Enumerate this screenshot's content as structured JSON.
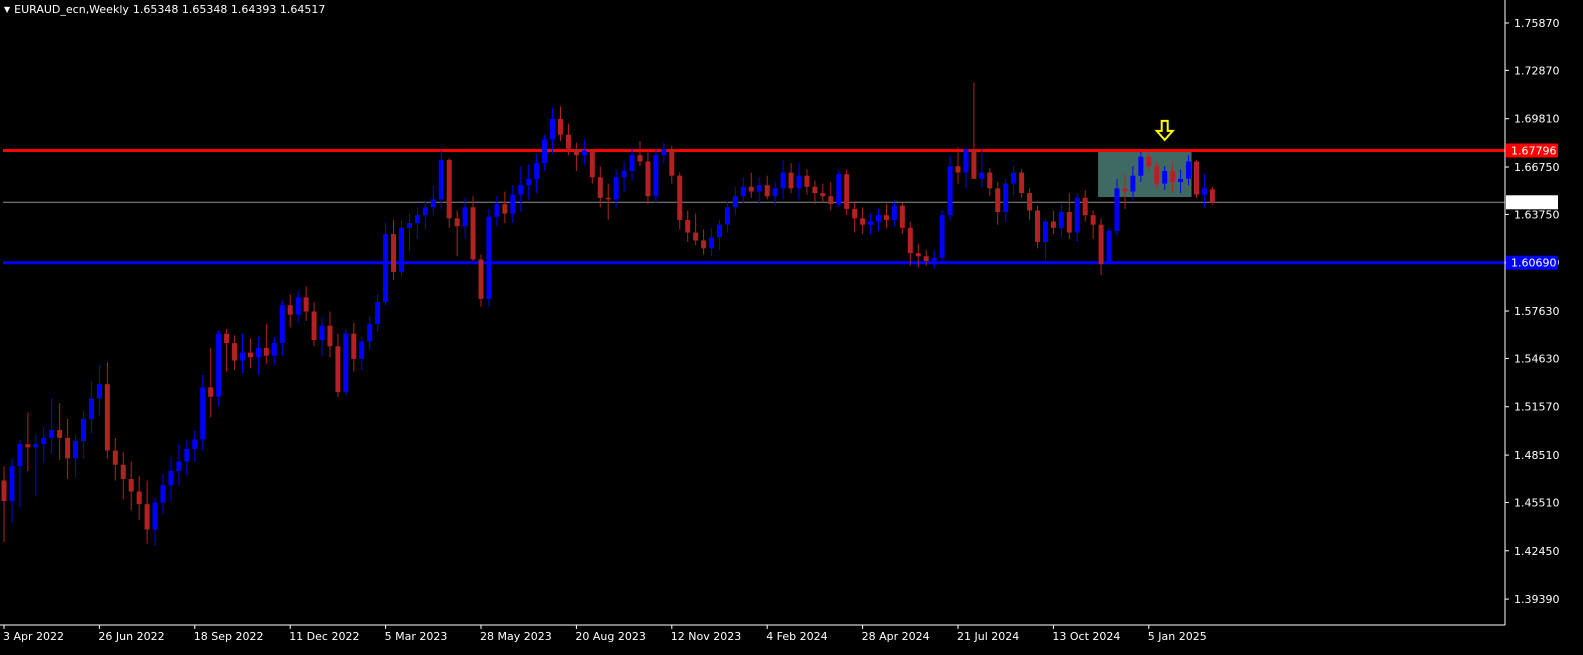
{
  "header": {
    "symbol_label": "EURAUD_ecn,Weekly",
    "ohlc_label": "1.65348 1.65348 1.64393 1.64517"
  },
  "colors": {
    "background": "#000000",
    "foreground": "#ffffff",
    "bull_candle": "#0000ff",
    "bear_candle": "#b22222",
    "resistance_line": "#ff0000",
    "support_line": "#0000ff",
    "price_line": "#8e8e8e",
    "zone_fill": "#3f6a63",
    "arrow": "#ffff00"
  },
  "chart_data": {
    "type": "candlestick",
    "title": "EURAUD_ecn,Weekly",
    "timeframe": "Weekly",
    "ylim": [
      1.3775,
      1.77326
    ],
    "y_ticks": [
      "1.75870",
      "1.72870",
      "1.69810",
      "1.66750",
      "1.63750",
      "1.60690",
      "1.57630",
      "1.54630",
      "1.51570",
      "1.48510",
      "1.45510",
      "1.42450",
      "1.39390"
    ],
    "x_ticks": [
      {
        "label": "3 Apr 2022",
        "index": 0
      },
      {
        "label": "26 Jun 2022",
        "index": 12
      },
      {
        "label": "18 Sep 2022",
        "index": 24
      },
      {
        "label": "11 Dec 2022",
        "index": 36
      },
      {
        "label": "5 Mar 2023",
        "index": 48
      },
      {
        "label": "28 May 2023",
        "index": 60
      },
      {
        "label": "20 Aug 2023",
        "index": 72
      },
      {
        "label": "12 Nov 2023",
        "index": 84
      },
      {
        "label": "4 Feb 2024",
        "index": 96
      },
      {
        "label": "28 Apr 2024",
        "index": 108
      },
      {
        "label": "21 Jul 2024",
        "index": 120
      },
      {
        "label": "13 Oct 2024",
        "index": 132
      },
      {
        "label": "5 Jan 2025",
        "index": 144
      }
    ],
    "levels": [
      {
        "name": "resistance",
        "value": 1.67796,
        "label": "1.67796"
      },
      {
        "name": "support",
        "value": 1.6069,
        "label": "1.60690"
      },
      {
        "name": "current",
        "value": 1.64517,
        "label": "1.64517"
      }
    ],
    "zone": {
      "from_index": 138,
      "to_index": 149,
      "high": 1.67796,
      "low": 1.6485
    },
    "arrow": {
      "index": 146,
      "direction": "down",
      "price": 1.6885
    },
    "ohlc": [
      [
        1.469,
        1.478,
        1.43,
        1.456
      ],
      [
        1.456,
        1.483,
        1.442,
        1.478
      ],
      [
        1.478,
        1.495,
        1.452,
        1.492
      ],
      [
        1.492,
        1.512,
        1.475,
        1.49
      ],
      [
        1.49,
        1.498,
        1.459,
        1.492
      ],
      [
        1.492,
        1.503,
        1.48,
        1.496
      ],
      [
        1.496,
        1.521,
        1.486,
        1.501
      ],
      [
        1.501,
        1.518,
        1.482,
        1.496
      ],
      [
        1.496,
        1.508,
        1.47,
        1.483
      ],
      [
        1.483,
        1.498,
        1.471,
        1.494
      ],
      [
        1.494,
        1.513,
        1.483,
        1.508
      ],
      [
        1.508,
        1.532,
        1.499,
        1.521
      ],
      [
        1.521,
        1.542,
        1.51,
        1.53
      ],
      [
        1.53,
        1.544,
        1.483,
        1.488
      ],
      [
        1.488,
        1.496,
        1.469,
        1.479
      ],
      [
        1.479,
        1.487,
        1.457,
        1.47
      ],
      [
        1.47,
        1.481,
        1.45,
        1.462
      ],
      [
        1.462,
        1.472,
        1.444,
        1.454
      ],
      [
        1.454,
        1.469,
        1.429,
        1.438
      ],
      [
        1.438,
        1.458,
        1.428,
        1.455
      ],
      [
        1.455,
        1.473,
        1.448,
        1.466
      ],
      [
        1.466,
        1.484,
        1.456,
        1.475
      ],
      [
        1.475,
        1.492,
        1.466,
        1.481
      ],
      [
        1.481,
        1.495,
        1.472,
        1.489
      ],
      [
        1.489,
        1.501,
        1.481,
        1.495
      ],
      [
        1.495,
        1.536,
        1.488,
        1.528
      ],
      [
        1.528,
        1.553,
        1.509,
        1.522
      ],
      [
        1.522,
        1.564,
        1.516,
        1.562
      ],
      [
        1.562,
        1.565,
        1.538,
        1.556
      ],
      [
        1.556,
        1.561,
        1.539,
        1.545
      ],
      [
        1.545,
        1.562,
        1.537,
        1.55
      ],
      [
        1.55,
        1.559,
        1.54,
        1.547
      ],
      [
        1.547,
        1.56,
        1.536,
        1.553
      ],
      [
        1.553,
        1.568,
        1.543,
        1.548
      ],
      [
        1.548,
        1.56,
        1.542,
        1.556
      ],
      [
        1.556,
        1.583,
        1.548,
        1.58
      ],
      [
        1.58,
        1.587,
        1.566,
        1.574
      ],
      [
        1.574,
        1.589,
        1.569,
        1.585
      ],
      [
        1.585,
        1.592,
        1.57,
        1.576
      ],
      [
        1.576,
        1.582,
        1.554,
        1.558
      ],
      [
        1.558,
        1.572,
        1.548,
        1.567
      ],
      [
        1.567,
        1.576,
        1.547,
        1.554
      ],
      [
        1.554,
        1.562,
        1.522,
        1.525
      ],
      [
        1.525,
        1.565,
        1.523,
        1.562
      ],
      [
        1.562,
        1.569,
        1.538,
        1.546
      ],
      [
        1.546,
        1.56,
        1.539,
        1.557
      ],
      [
        1.557,
        1.573,
        1.552,
        1.568
      ],
      [
        1.568,
        1.587,
        1.563,
        1.582
      ],
      [
        1.582,
        1.632,
        1.58,
        1.625
      ],
      [
        1.625,
        1.634,
        1.596,
        1.601
      ],
      [
        1.601,
        1.634,
        1.598,
        1.629
      ],
      [
        1.629,
        1.638,
        1.614,
        1.632
      ],
      [
        1.632,
        1.642,
        1.622,
        1.637
      ],
      [
        1.637,
        1.646,
        1.628,
        1.642
      ],
      [
        1.642,
        1.656,
        1.637,
        1.647
      ],
      [
        1.647,
        1.678,
        1.641,
        1.672
      ],
      [
        1.672,
        1.673,
        1.629,
        1.635
      ],
      [
        1.635,
        1.64,
        1.611,
        1.63
      ],
      [
        1.63,
        1.648,
        1.622,
        1.642
      ],
      [
        1.642,
        1.649,
        1.608,
        1.609
      ],
      [
        1.609,
        1.612,
        1.579,
        1.584
      ],
      [
        1.584,
        1.641,
        1.579,
        1.636
      ],
      [
        1.636,
        1.649,
        1.63,
        1.644
      ],
      [
        1.644,
        1.652,
        1.632,
        1.638
      ],
      [
        1.638,
        1.656,
        1.632,
        1.65
      ],
      [
        1.65,
        1.668,
        1.639,
        1.656
      ],
      [
        1.656,
        1.669,
        1.647,
        1.66
      ],
      [
        1.66,
        1.676,
        1.651,
        1.67
      ],
      [
        1.67,
        1.688,
        1.665,
        1.685
      ],
      [
        1.685,
        1.705,
        1.676,
        1.698
      ],
      [
        1.698,
        1.706,
        1.684,
        1.688
      ],
      [
        1.688,
        1.695,
        1.675,
        1.679
      ],
      [
        1.679,
        1.683,
        1.665,
        1.675
      ],
      [
        1.675,
        1.685,
        1.669,
        1.678
      ],
      [
        1.678,
        1.679,
        1.657,
        1.661
      ],
      [
        1.661,
        1.668,
        1.642,
        1.648
      ],
      [
        1.648,
        1.657,
        1.634,
        1.647
      ],
      [
        1.647,
        1.666,
        1.642,
        1.661
      ],
      [
        1.661,
        1.671,
        1.652,
        1.665
      ],
      [
        1.665,
        1.679,
        1.659,
        1.675
      ],
      [
        1.675,
        1.684,
        1.668,
        1.671
      ],
      [
        1.671,
        1.677,
        1.644,
        1.649
      ],
      [
        1.649,
        1.679,
        1.645,
        1.675
      ],
      [
        1.675,
        1.683,
        1.67,
        1.679
      ],
      [
        1.679,
        1.681,
        1.657,
        1.662
      ],
      [
        1.662,
        1.664,
        1.628,
        1.634
      ],
      [
        1.634,
        1.64,
        1.62,
        1.626
      ],
      [
        1.626,
        1.638,
        1.618,
        1.621
      ],
      [
        1.621,
        1.628,
        1.612,
        1.616
      ],
      [
        1.616,
        1.629,
        1.611,
        1.623
      ],
      [
        1.623,
        1.634,
        1.615,
        1.631
      ],
      [
        1.631,
        1.646,
        1.626,
        1.642
      ],
      [
        1.642,
        1.655,
        1.637,
        1.649
      ],
      [
        1.649,
        1.661,
        1.645,
        1.655
      ],
      [
        1.655,
        1.664,
        1.648,
        1.652
      ],
      [
        1.652,
        1.661,
        1.644,
        1.656
      ],
      [
        1.656,
        1.662,
        1.647,
        1.649
      ],
      [
        1.649,
        1.658,
        1.643,
        1.654
      ],
      [
        1.654,
        1.672,
        1.647,
        1.664
      ],
      [
        1.664,
        1.67,
        1.651,
        1.654
      ],
      [
        1.654,
        1.67,
        1.647,
        1.662
      ],
      [
        1.662,
        1.666,
        1.65,
        1.655
      ],
      [
        1.655,
        1.659,
        1.644,
        1.651
      ],
      [
        1.651,
        1.657,
        1.645,
        1.649
      ],
      [
        1.649,
        1.658,
        1.64,
        1.644
      ],
      [
        1.644,
        1.665,
        1.642,
        1.663
      ],
      [
        1.663,
        1.666,
        1.637,
        1.641
      ],
      [
        1.641,
        1.645,
        1.626,
        1.635
      ],
      [
        1.635,
        1.642,
        1.625,
        1.631
      ],
      [
        1.631,
        1.638,
        1.625,
        1.633
      ],
      [
        1.633,
        1.641,
        1.627,
        1.637
      ],
      [
        1.637,
        1.644,
        1.629,
        1.634
      ],
      [
        1.634,
        1.647,
        1.63,
        1.643
      ],
      [
        1.643,
        1.645,
        1.625,
        1.629
      ],
      [
        1.629,
        1.633,
        1.605,
        1.613
      ],
      [
        1.613,
        1.619,
        1.604,
        1.611
      ],
      [
        1.611,
        1.615,
        1.605,
        1.608
      ],
      [
        1.608,
        1.615,
        1.603,
        1.61
      ],
      [
        1.61,
        1.64,
        1.608,
        1.637
      ],
      [
        1.637,
        1.675,
        1.633,
        1.668
      ],
      [
        1.668,
        1.68,
        1.657,
        1.664
      ],
      [
        1.664,
        1.679,
        1.654,
        1.679
      ],
      [
        1.679,
        1.721,
        1.67,
        1.66
      ],
      [
        1.66,
        1.679,
        1.655,
        1.664
      ],
      [
        1.664,
        1.667,
        1.649,
        1.654
      ],
      [
        1.654,
        1.658,
        1.631,
        1.639
      ],
      [
        1.639,
        1.66,
        1.633,
        1.657
      ],
      [
        1.657,
        1.668,
        1.649,
        1.664
      ],
      [
        1.664,
        1.666,
        1.648,
        1.651
      ],
      [
        1.651,
        1.654,
        1.634,
        1.64
      ],
      [
        1.64,
        1.643,
        1.616,
        1.62
      ],
      [
        1.62,
        1.635,
        1.609,
        1.633
      ],
      [
        1.633,
        1.64,
        1.625,
        1.629
      ],
      [
        1.629,
        1.644,
        1.623,
        1.639
      ],
      [
        1.639,
        1.651,
        1.622,
        1.626
      ],
      [
        1.626,
        1.651,
        1.62,
        1.648
      ],
      [
        1.648,
        1.653,
        1.633,
        1.637
      ],
      [
        1.637,
        1.64,
        1.622,
        1.631
      ],
      [
        1.631,
        1.635,
        1.599,
        1.606
      ],
      [
        1.606,
        1.629,
        1.606,
        1.627
      ],
      [
        1.627,
        1.66,
        1.624,
        1.654
      ],
      [
        1.654,
        1.663,
        1.641,
        1.652
      ],
      [
        1.652,
        1.668,
        1.647,
        1.662
      ],
      [
        1.662,
        1.677,
        1.658,
        1.674
      ],
      [
        1.674,
        1.679,
        1.665,
        1.668
      ],
      [
        1.668,
        1.671,
        1.654,
        1.657
      ],
      [
        1.657,
        1.668,
        1.653,
        1.665
      ],
      [
        1.665,
        1.671,
        1.651,
        1.658
      ],
      [
        1.658,
        1.666,
        1.651,
        1.66
      ],
      [
        1.66,
        1.675,
        1.656,
        1.671
      ],
      [
        1.671,
        1.672,
        1.648,
        1.65
      ],
      [
        1.65,
        1.663,
        1.642,
        1.654
      ],
      [
        1.6534,
        1.655,
        1.6439,
        1.6452
      ]
    ]
  }
}
